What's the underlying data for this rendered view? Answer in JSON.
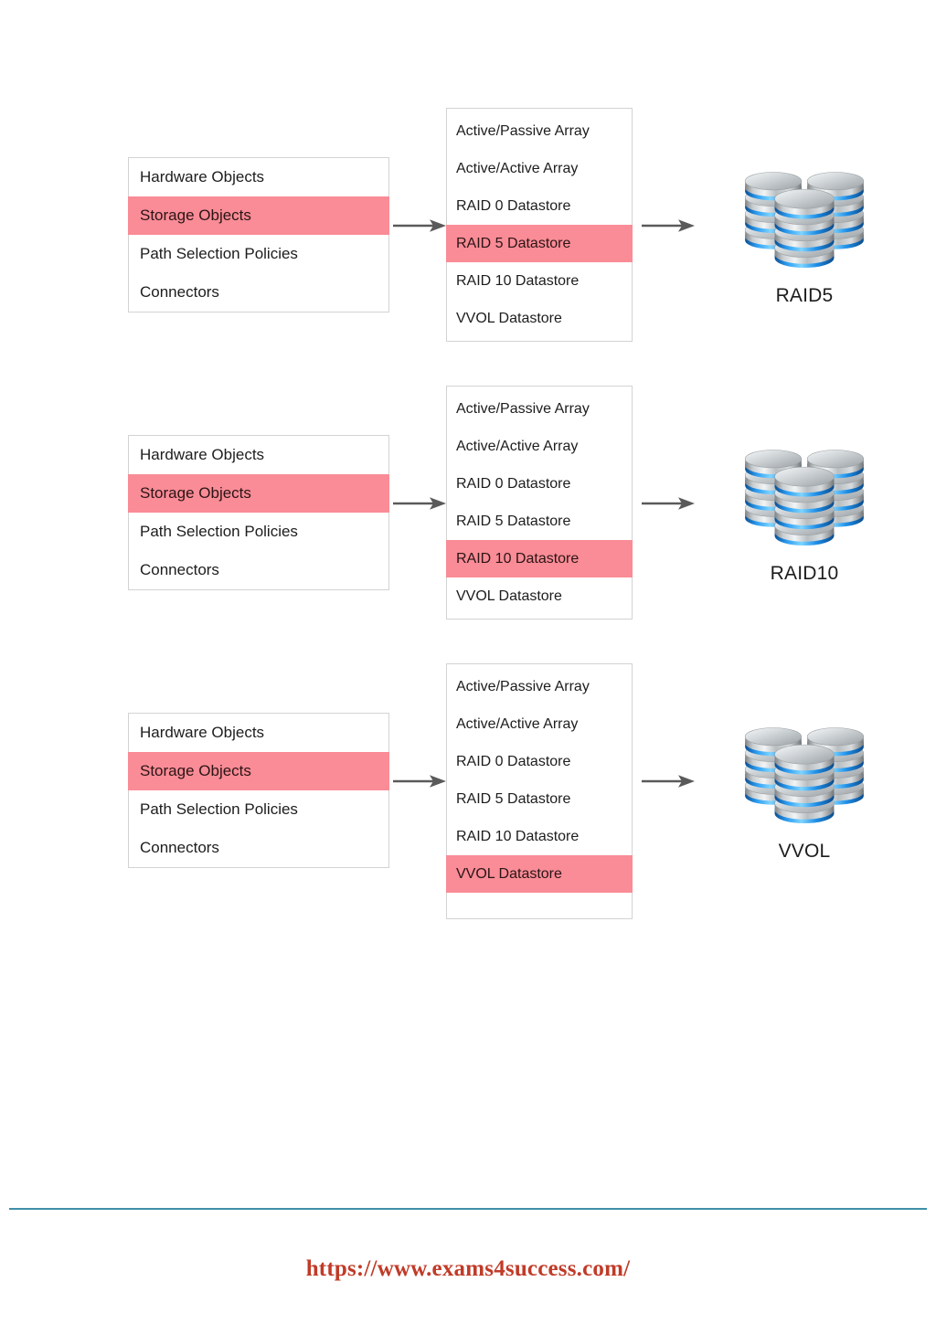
{
  "colors": {
    "highlight_pink": "#F98C96",
    "panel_border": "#d3d3d3",
    "arrow_gray": "#5a5a5a",
    "footer_rule_blue": "#3f8fa8",
    "footer_link_red": "#c03b28",
    "disk_band_blue": "#1e8fe8",
    "disk_silver": "#c9cbcc"
  },
  "groups": [
    {
      "left_panel": {
        "name": "hardware-storage-category-list",
        "rows": [
          {
            "label": "Hardware Objects",
            "selected": false
          },
          {
            "label": "Storage Objects",
            "selected": true
          },
          {
            "label": "Path Selection Policies",
            "selected": false
          },
          {
            "label": "Connectors",
            "selected": false
          }
        ]
      },
      "middle_panel": {
        "name": "storage-object-type-list",
        "rows": [
          {
            "label": "Active/Passive Array",
            "selected": false
          },
          {
            "label": "Active/Active Array",
            "selected": false
          },
          {
            "label": "RAID 0 Datastore",
            "selected": false
          },
          {
            "label": "RAID 5 Datastore",
            "selected": true
          },
          {
            "label": "RAID 10 Datastore",
            "selected": false
          },
          {
            "label": "VVOL Datastore",
            "selected": false
          }
        ]
      },
      "result": {
        "icon": "disk-cluster-icon",
        "label": "RAID5"
      }
    },
    {
      "left_panel": {
        "name": "hardware-storage-category-list",
        "rows": [
          {
            "label": "Hardware Objects",
            "selected": false
          },
          {
            "label": "Storage Objects",
            "selected": true
          },
          {
            "label": "Path Selection Policies",
            "selected": false
          },
          {
            "label": "Connectors",
            "selected": false
          }
        ]
      },
      "middle_panel": {
        "name": "storage-object-type-list",
        "rows": [
          {
            "label": "Active/Passive Array",
            "selected": false
          },
          {
            "label": "Active/Active Array",
            "selected": false
          },
          {
            "label": "RAID 0 Datastore",
            "selected": false
          },
          {
            "label": "RAID 5 Datastore",
            "selected": false
          },
          {
            "label": "RAID 10 Datastore",
            "selected": true
          },
          {
            "label": "VVOL Datastore",
            "selected": false
          }
        ]
      },
      "result": {
        "icon": "disk-cluster-icon",
        "label": "RAID10"
      }
    },
    {
      "left_panel": {
        "name": "hardware-storage-category-list",
        "rows": [
          {
            "label": "Hardware Objects",
            "selected": false
          },
          {
            "label": "Storage Objects",
            "selected": true
          },
          {
            "label": "Path Selection Policies",
            "selected": false
          },
          {
            "label": "Connectors",
            "selected": false
          }
        ]
      },
      "middle_panel": {
        "name": "storage-object-type-list",
        "rows": [
          {
            "label": "Active/Passive Array",
            "selected": false
          },
          {
            "label": "Active/Active Array",
            "selected": false
          },
          {
            "label": "RAID 0 Datastore",
            "selected": false
          },
          {
            "label": "RAID 5 Datastore",
            "selected": false
          },
          {
            "label": "RAID 10 Datastore",
            "selected": false
          },
          {
            "label": "VVOL Datastore",
            "selected": true
          }
        ]
      },
      "result": {
        "icon": "disk-cluster-icon",
        "label": "VVOL"
      }
    }
  ],
  "arrows": {
    "icon": "arrow-right-icon",
    "count_per_group": 2
  },
  "footer": {
    "url": "https://www.exams4success.com/"
  }
}
